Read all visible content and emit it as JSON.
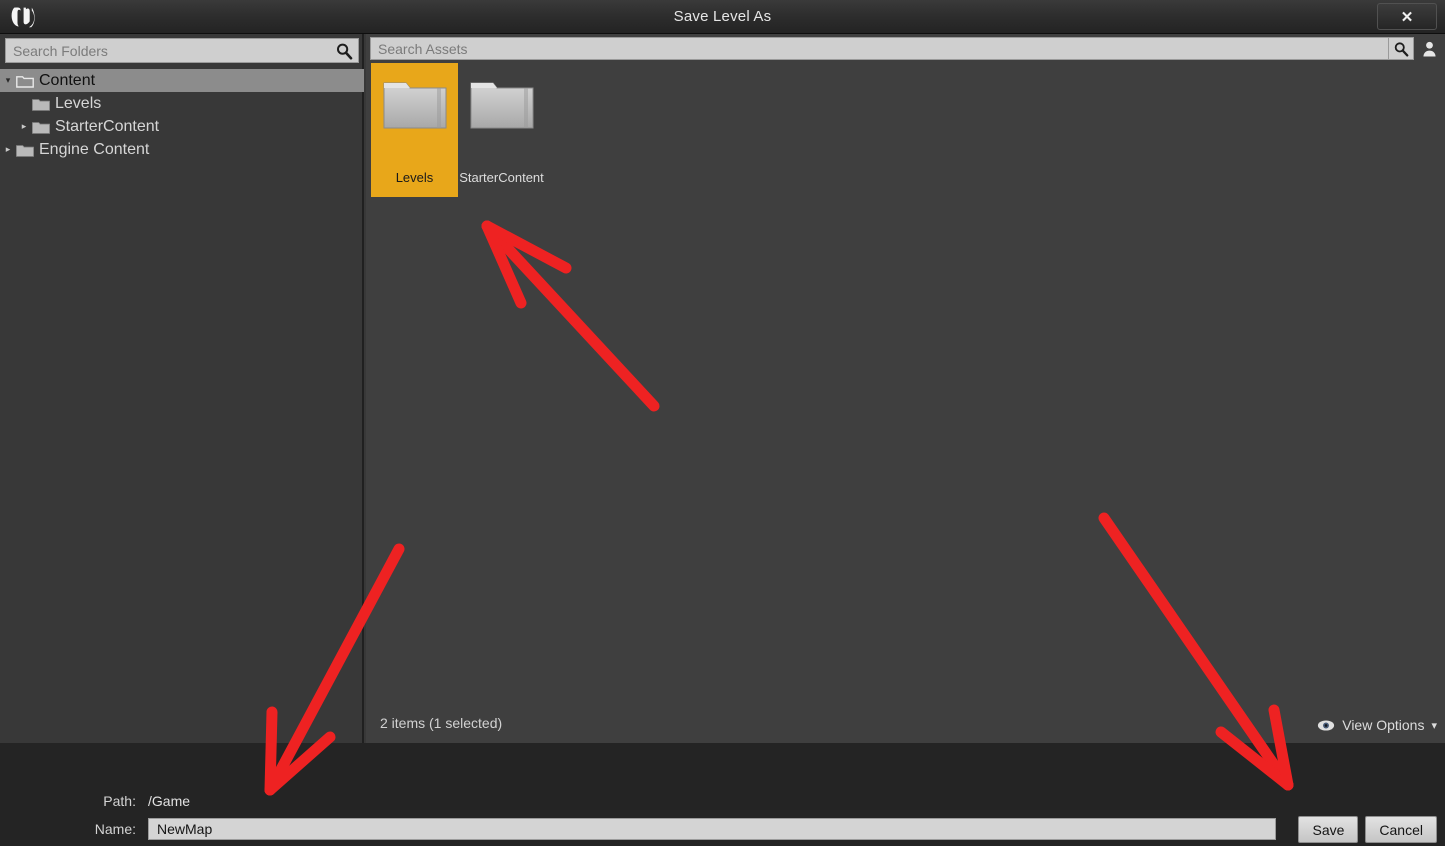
{
  "window": {
    "title": "Save Level As",
    "logo_icon": "unreal-engine-logo",
    "close_icon": "close-icon",
    "close_label": "✕"
  },
  "left_panel": {
    "search": {
      "placeholder": "Search Folders",
      "value": "",
      "icon": "search-icon"
    },
    "tree": [
      {
        "label": "Content",
        "level": 1,
        "twisty": "▾",
        "expanded": true,
        "selected": true,
        "icon": "folder-open-icon"
      },
      {
        "label": "Levels",
        "level": 2,
        "twisty": "",
        "expanded": false,
        "selected": false,
        "icon": "folder-icon"
      },
      {
        "label": "StarterContent",
        "level": 2,
        "twisty": "▸",
        "expanded": false,
        "selected": false,
        "icon": "folder-icon"
      },
      {
        "label": "Engine Content",
        "level": 1,
        "twisty": "▸",
        "expanded": false,
        "selected": false,
        "icon": "folder-icon"
      }
    ]
  },
  "right_panel": {
    "search": {
      "placeholder": "Search Assets",
      "value": "",
      "icon": "search-icon"
    },
    "toolbar_icons": [
      {
        "name": "search-icon",
        "glyph": "search"
      },
      {
        "name": "user-icon",
        "glyph": "user"
      }
    ],
    "tiles": [
      {
        "label": "Levels",
        "selected": true,
        "icon": "folder-icon"
      },
      {
        "label": "StarterContent",
        "selected": false,
        "icon": "folder-icon"
      }
    ],
    "status": "2 items (1 selected)",
    "view_options": {
      "label": "View Options",
      "eye_icon": "eye-icon",
      "chevron": "▾"
    }
  },
  "footer": {
    "path_label": "Path:",
    "path_value": "/Game",
    "name_label": "Name:",
    "name_value": "NewMap",
    "save_label": "Save",
    "cancel_label": "Cancel"
  },
  "annotations": {
    "color": "#ee2222",
    "arrows": [
      {
        "name": "arrow-to-levels-folder",
        "target": "Levels tile"
      },
      {
        "name": "arrow-to-name-field",
        "target": "Name input"
      },
      {
        "name": "arrow-to-save-button",
        "target": "Save button"
      }
    ]
  },
  "colors": {
    "selection_orange": "#e8a71a",
    "panel_bg": "#3f3f3f",
    "sidebar_bg": "#383838",
    "footer_bg": "#242424",
    "annotation_red": "#ee2222"
  }
}
